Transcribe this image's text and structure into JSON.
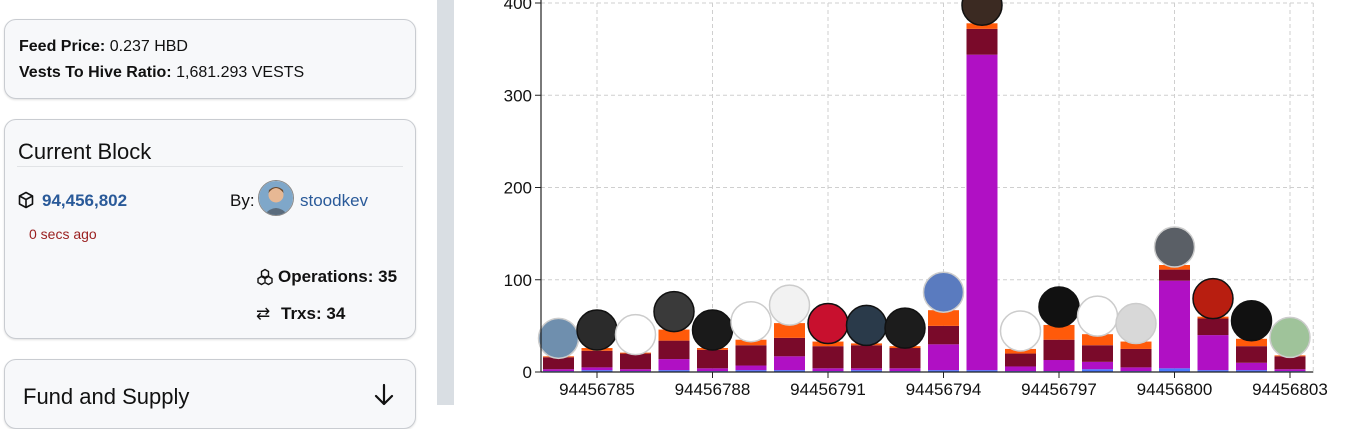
{
  "feed": {
    "price_label": "Feed Price:",
    "price_value": "0.237 HBD",
    "ratio_label": "Vests To Hive Ratio:",
    "ratio_value": "1,681.293 VESTS"
  },
  "current_block": {
    "title": "Current Block",
    "block_number": "94,456,802",
    "time_ago": "0 secs ago",
    "by_label": "By:",
    "producer": "stoodkev",
    "operations_label": "Operations:",
    "operations_value": "35",
    "trxs_label": "Trxs:",
    "trxs_value": "34"
  },
  "fund": {
    "title": "Fund and Supply"
  },
  "icons": {
    "block": "cube-icon",
    "operations": "operations-icon",
    "trxs": "transfer-arrows-icon",
    "expand": "arrow-down-icon"
  },
  "colors": {
    "link": "#2a5a99",
    "time_ago": "#9a1f1f",
    "series_magenta": "#b010c4",
    "series_maroon": "#7a0a2a",
    "series_orange": "#ff5a0a",
    "series_blue": "#4a78ff"
  },
  "chart_data": {
    "type": "bar",
    "stacked": true,
    "ylim": [
      0,
      400
    ],
    "yticks": [
      0,
      100,
      200,
      300,
      400
    ],
    "grid": true,
    "x_tick_labels": [
      "94456785",
      "94456788",
      "94456791",
      "94456794",
      "94456797",
      "94456800",
      "94456803"
    ],
    "categories": [
      "94456784",
      "94456785",
      "94456786",
      "94456787",
      "94456788",
      "94456789",
      "94456790",
      "94456791",
      "94456792",
      "94456793",
      "94456794",
      "94456795",
      "94456796",
      "94456797",
      "94456798",
      "94456799",
      "94456800",
      "94456801",
      "94456802",
      "94456803"
    ],
    "series": [
      {
        "color": "#4a78ff",
        "values": [
          1,
          2,
          1,
          2,
          1,
          2,
          2,
          1,
          2,
          1,
          2,
          2,
          1,
          1,
          3,
          1,
          4,
          2,
          2,
          1
        ]
      },
      {
        "color": "#b010c4",
        "values": [
          2,
          3,
          2,
          12,
          3,
          5,
          15,
          3,
          2,
          3,
          28,
          342,
          5,
          12,
          8,
          4,
          95,
          38,
          8,
          2
        ]
      },
      {
        "color": "#7a0a2a",
        "values": [
          13,
          18,
          17,
          20,
          20,
          22,
          20,
          24,
          25,
          22,
          20,
          28,
          14,
          22,
          18,
          20,
          12,
          18,
          18,
          14
        ]
      },
      {
        "color": "#ff5a0a",
        "values": [
          1,
          3,
          1,
          12,
          2,
          6,
          16,
          5,
          2,
          2,
          17,
          6,
          5,
          16,
          12,
          8,
          5,
          2,
          8,
          1
        ]
      }
    ]
  }
}
